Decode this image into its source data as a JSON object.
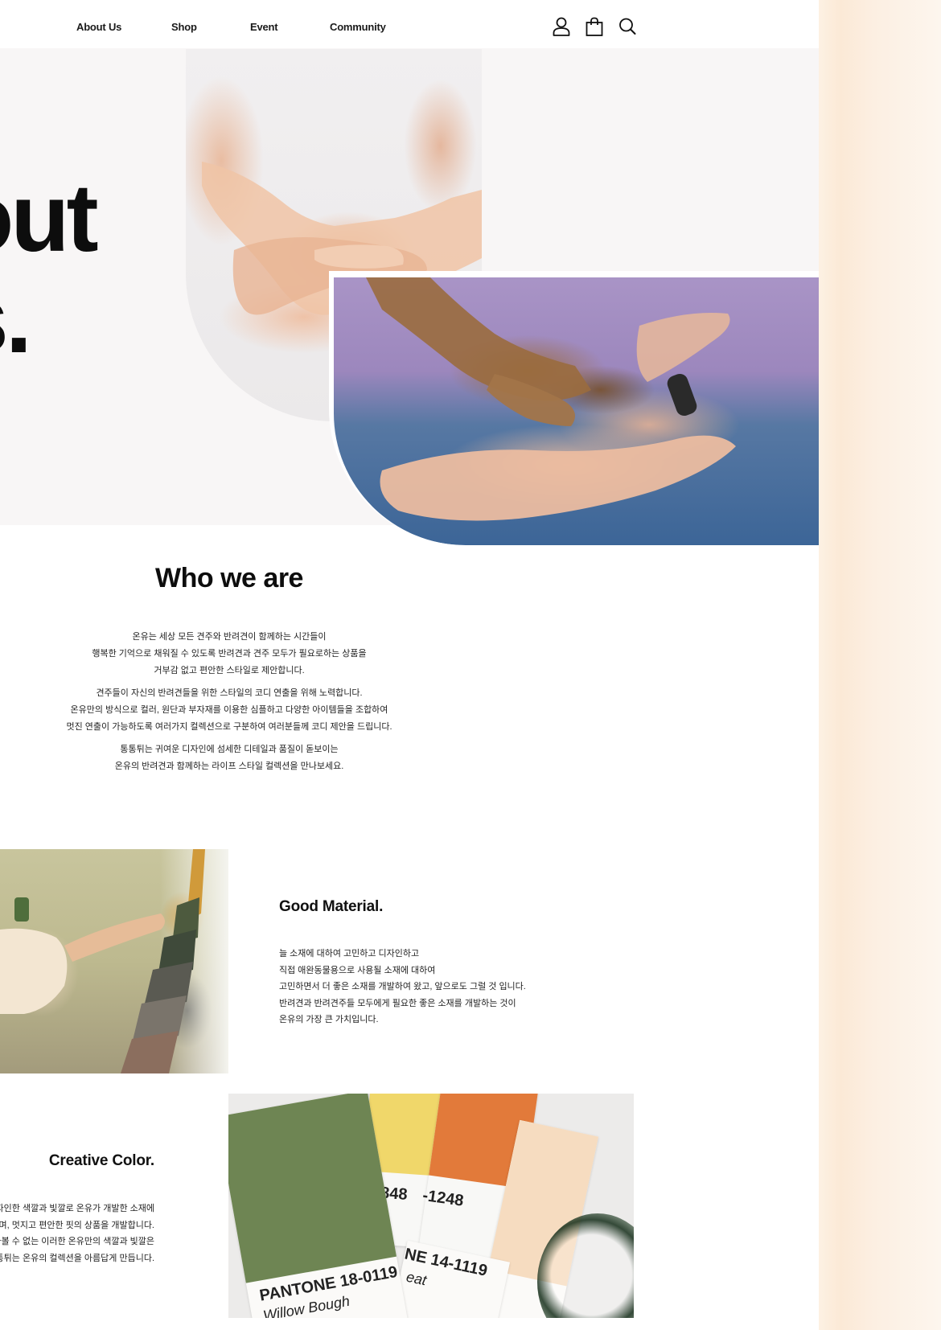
{
  "nav": {
    "links": [
      "About Us",
      "Shop",
      "Event",
      "Community"
    ],
    "icons": [
      "user-icon",
      "shopping-bag-icon",
      "search-icon"
    ]
  },
  "hero": {
    "title_line1": "out",
    "title_line2": "s."
  },
  "who": {
    "title": "Who we are",
    "paragraphs": [
      [
        "온유는 세상 모든 견주와 반려견이 함께하는 시간들이",
        "행복한 기억으로 채워질 수 있도록 반려견과 견주 모두가 필요로하는 상품을",
        "거부감 없고 편안한 스타일로 제안합니다."
      ],
      [
        "견주들이 자신의 반려견들을 위한 스타일의 코디 연출을 위해 노력합니다.",
        "온유만의 방식으로 컬러, 원단과 부자재를 이용한 심플하고 다양한 아이템들을 조합하여",
        "멋진 연출이 가능하도록 여러가지 컬렉션으로 구분하여 여러분들께 코디 제안을 드립니다."
      ],
      [
        "통통튀는 귀여운 디자인에 섬세한 디테일과 품질이 돋보이는",
        "온유의 반려견과 함께하는 라이프 스타일 컬렉션을 만나보세요."
      ]
    ]
  },
  "material": {
    "title": "Good Material.",
    "lines": [
      "늘 소재에 대하여 고민하고 디자인하고",
      "직접 애완동물용으로 사용될 소재에 대하여",
      "고민하면서 더 좋은 소재를 개발하여 왔고, 앞으로도 그럴 것 입니다.",
      "반려견과 반려견주들 모두에게 필요한 좋은 소재를 개발하는 것이",
      "온유의 가장 큰 가치입니다."
    ]
  },
  "color": {
    "title": "Creative Color.",
    "lines": [
      "자인한 색깔과 빛깔로 온유가 개발한 소재에",
      "하며, 멋지고 편안한 핏의 상품을 개발합니다.",
      "아볼 수 없는 이러한 온유만의 색깔과 빛깔은",
      "통통튀는 온유의 컬렉션을 아름답게 만듭니다."
    ],
    "pantone_labels": {
      "green_code": "PANTONE 18-0119",
      "green_name": "Willow Bough",
      "yellow_code": "848",
      "orange_code": "-1248",
      "peach_code": "NE 14-1119",
      "peach_name": "eat"
    },
    "swatch_colors": [
      "#6e8553",
      "#f0d76a",
      "#e27a3a",
      "#f6dcc0"
    ]
  },
  "colors": {
    "hero_bg": "#f8f6f6",
    "side_gradient": "#fbe9d6"
  }
}
